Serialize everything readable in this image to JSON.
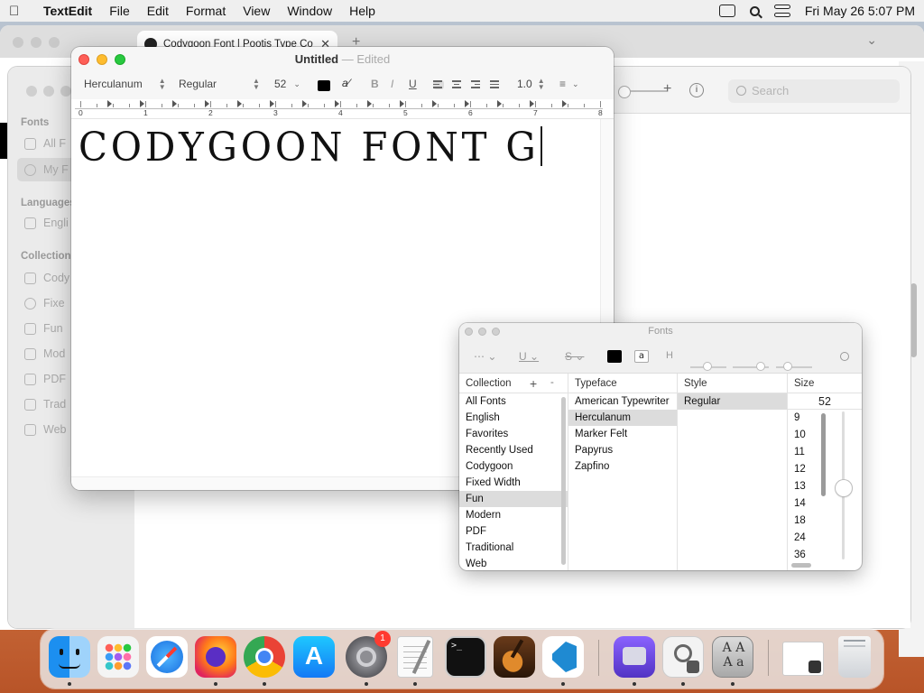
{
  "menubar": {
    "app_name": "TextEdit",
    "menus": [
      "File",
      "Edit",
      "Format",
      "View",
      "Window",
      "Help"
    ],
    "clock": "Fri May 26  5:07 PM"
  },
  "browser": {
    "tab_title": "Codygoon Font | Pootis Type Co"
  },
  "fontbook": {
    "sections": {
      "fonts": "Fonts",
      "languages": "Languages",
      "collections": "Collection"
    },
    "font_items": [
      "All F",
      "My F"
    ],
    "language_items": [
      "Engli"
    ],
    "collection_items": [
      "Cody",
      "Fixe",
      "Fun",
      "Mod",
      "PDF",
      "Trad",
      "Web"
    ],
    "search_placeholder": "Search"
  },
  "textedit": {
    "doc_name": "Untitled",
    "separator": "—",
    "edited_label": "Edited",
    "toolbar": {
      "font_family": "Herculanum",
      "font_style": "Regular",
      "font_size": "52",
      "bold": "B",
      "italic": "I",
      "underline": "U",
      "line_spacing": "1.0"
    },
    "ruler_numbers": [
      "0",
      "1",
      "2",
      "3",
      "4",
      "5",
      "6",
      "7",
      "8"
    ],
    "document_text": "CODYGOON FONT G"
  },
  "fonts_panel": {
    "title": "Fonts",
    "headers": {
      "collection": "Collection",
      "typeface": "Typeface",
      "style": "Style",
      "size": "Size"
    },
    "collections": [
      "All Fonts",
      "English",
      "Favorites",
      "Recently Used",
      "Codygoon",
      "Fixed Width",
      "Fun",
      "Modern",
      "PDF",
      "Traditional",
      "Web"
    ],
    "selected_collection": "Fun",
    "typefaces": [
      "American Typewriter",
      "Herculanum",
      "Marker Felt",
      "Papyrus",
      "Zapfino"
    ],
    "selected_typeface": "Herculanum",
    "styles": [
      "Regular"
    ],
    "size_value": "52",
    "sizes": [
      "9",
      "10",
      "11",
      "12",
      "13",
      "14",
      "18",
      "24",
      "36"
    ],
    "add_button": "+",
    "remove_button": "-",
    "text_color_sample": "a"
  },
  "dock": {
    "settings_badge": "1"
  }
}
